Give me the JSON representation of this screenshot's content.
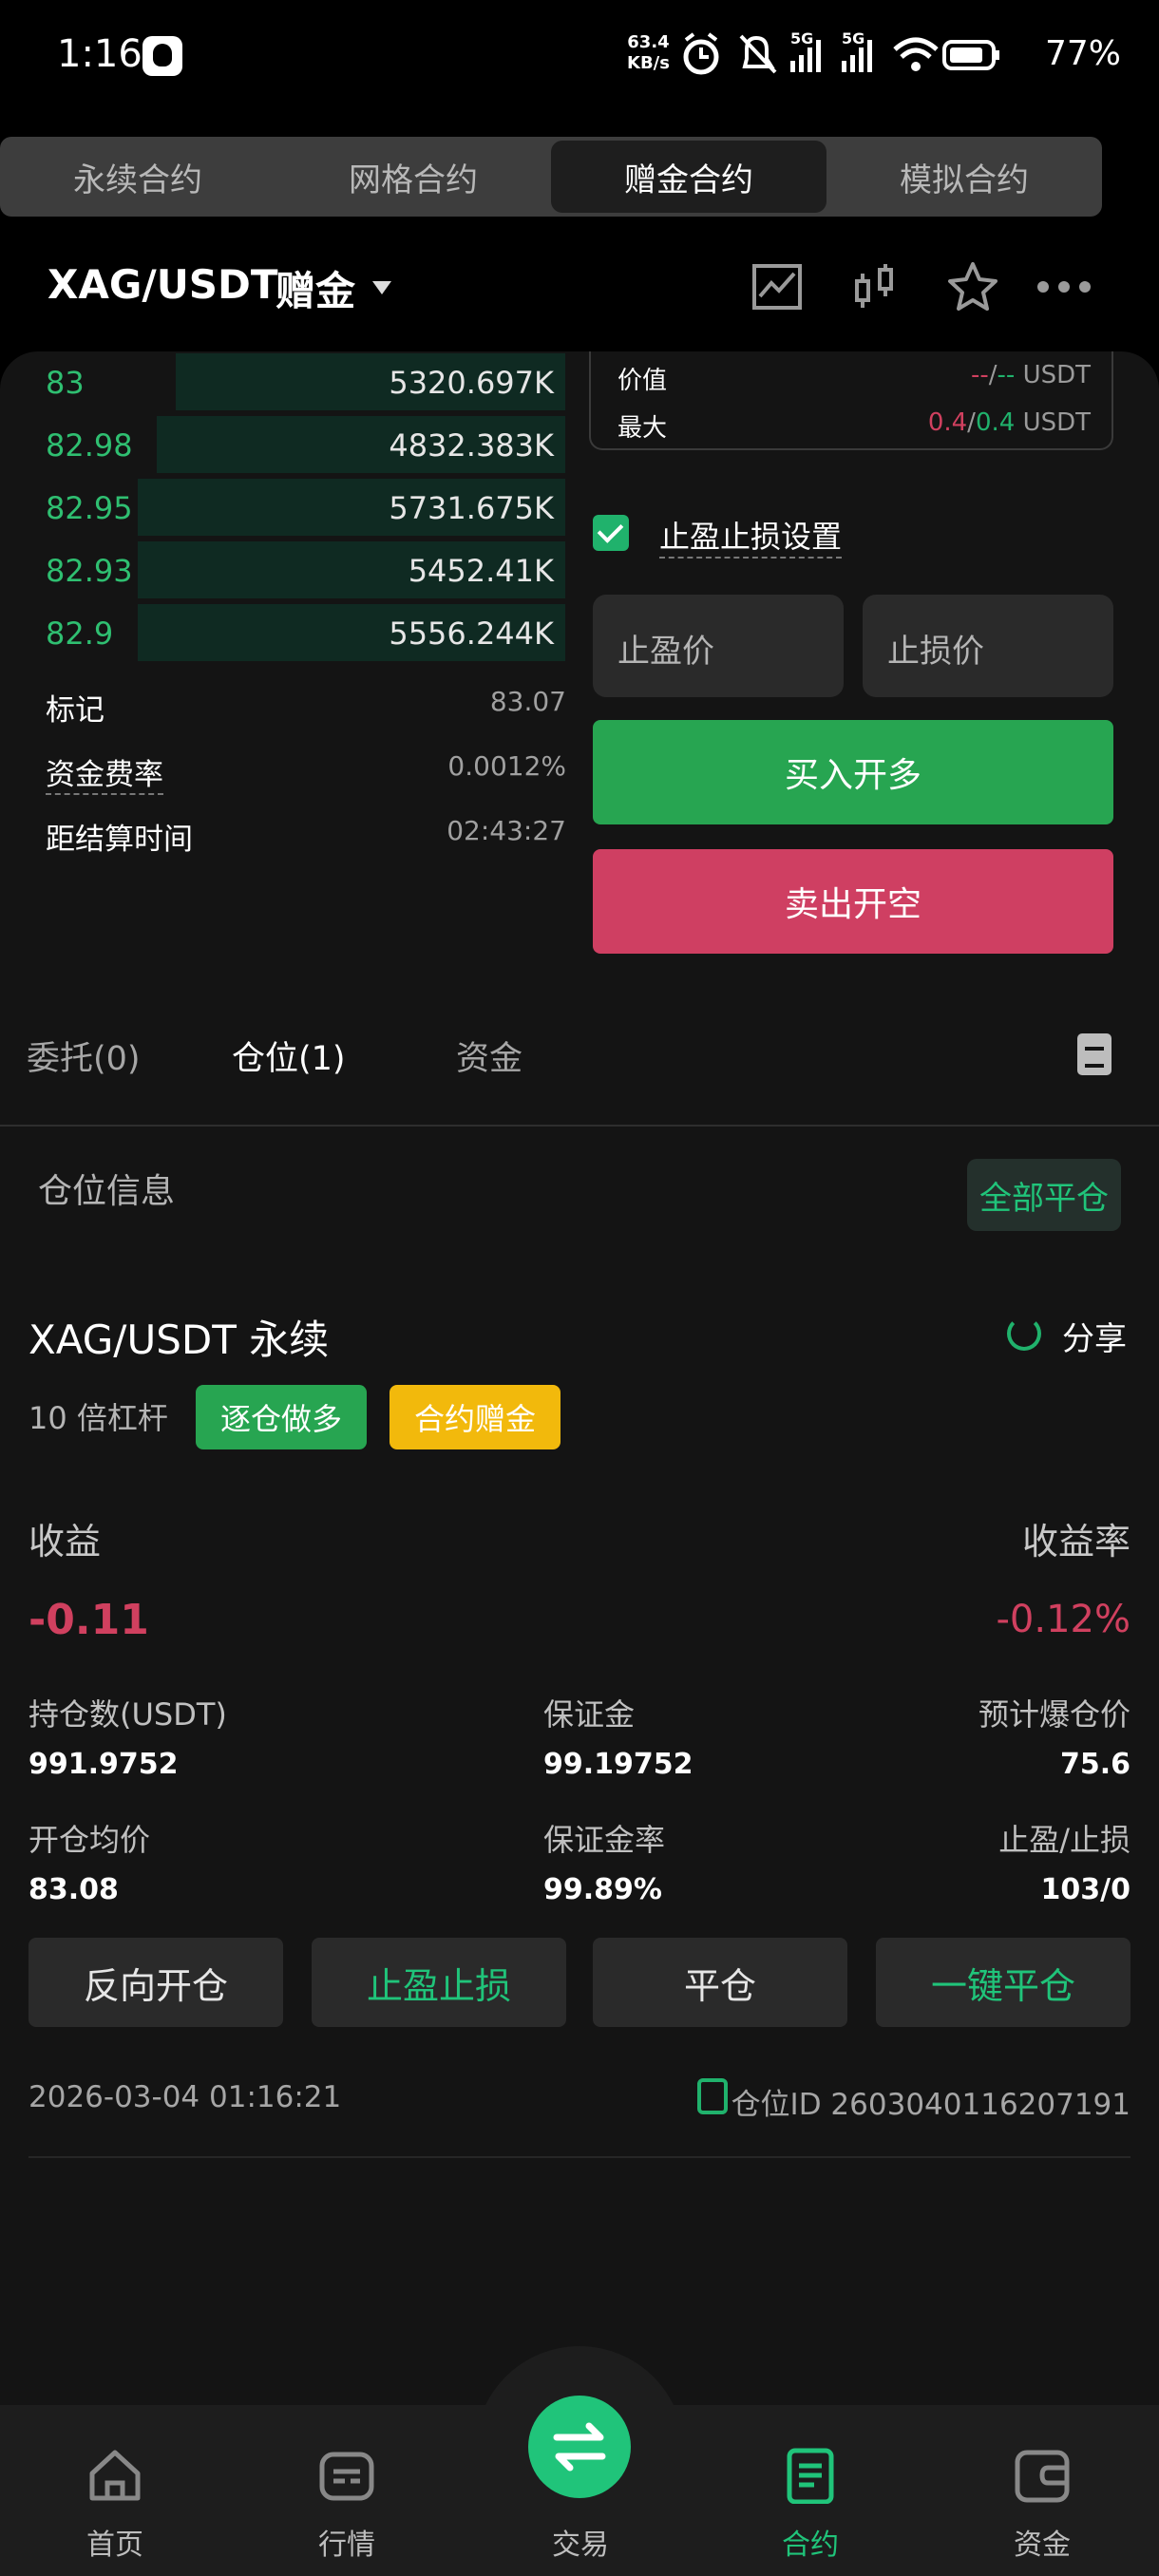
{
  "status_bar": {
    "time": "1:16",
    "net_speed_value": "63.4",
    "net_speed_unit": "KB/s",
    "signal1": "5G",
    "signal2": "5G",
    "battery": "77%"
  },
  "tabs": [
    {
      "label": "永续合约"
    },
    {
      "label": "网格合约"
    },
    {
      "label": "赠金合约"
    },
    {
      "label": "模拟合约"
    }
  ],
  "pair": {
    "symbol": "XAG/USDT",
    "tag": "赠金"
  },
  "order_book": [
    {
      "price": "83",
      "qty": "5320.697K",
      "depth": 0.82
    },
    {
      "price": "82.98",
      "qty": "4832.383K",
      "depth": 0.86
    },
    {
      "price": "82.95",
      "qty": "5731.675K",
      "depth": 0.9
    },
    {
      "price": "82.93",
      "qty": "5452.41K",
      "depth": 0.9
    },
    {
      "price": "82.9",
      "qty": "5556.244K",
      "depth": 0.9
    }
  ],
  "market_info": {
    "mark_label": "标记",
    "mark_value": "83.07",
    "funding_label": "资金费率",
    "funding_value": "0.0012%",
    "settle_label": "距结算时间",
    "settle_value": "02:43:27"
  },
  "order_panel": {
    "value_label": "价值",
    "value_long": "--",
    "value_short": "--",
    "value_unit": "USDT",
    "max_label": "最大",
    "max_long": "0.4",
    "max_short": "0.4",
    "max_unit": "USDT",
    "tpsl_label": "止盈止损设置",
    "tp_placeholder": "止盈价",
    "sl_placeholder": "止损价",
    "buy_label": "买入开多",
    "sell_label": "卖出开空"
  },
  "position_tabs": [
    {
      "label": "委托(0)"
    },
    {
      "label": "仓位(1)"
    },
    {
      "label": "资金"
    }
  ],
  "position": {
    "section_title": "仓位信息",
    "close_all": "全部平仓",
    "symbol": "XAG/USDT 永续",
    "share": "分享",
    "leverage": "10 倍杠杆",
    "badge_mode": "逐仓做多",
    "badge_bonus": "合约赠金",
    "pnl_label": "收益",
    "roe_label": "收益率",
    "pnl_value": "-0.11",
    "roe_value": "-0.12%",
    "size_label": "持仓数(USDT)",
    "size_value": "991.9752",
    "margin_label": "保证金",
    "margin_value": "99.19752",
    "liq_label": "预计爆仓价",
    "liq_value": "75.6",
    "entry_label": "开仓均价",
    "entry_value": "83.08",
    "margin_ratio_label": "保证金率",
    "margin_ratio_value": "99.89%",
    "tpsl_label": "止盈/止损",
    "tpsl_value": "103/0",
    "btn_reverse": "反向开仓",
    "btn_tpsl": "止盈止损",
    "btn_close": "平仓",
    "btn_quick_close": "一键平仓",
    "timestamp": "2026-03-04 01:16:21",
    "position_id": "仓位ID 2603040116207191"
  },
  "bottom_nav": [
    {
      "label": "首页"
    },
    {
      "label": "行情"
    },
    {
      "label": "交易"
    },
    {
      "label": "合约"
    },
    {
      "label": "资金"
    }
  ],
  "colors": {
    "green": "#20b26c",
    "red": "#d0405f",
    "buy": "#27a551",
    "sell": "#cf3f62",
    "bonus_badge": "#f2b90c"
  }
}
